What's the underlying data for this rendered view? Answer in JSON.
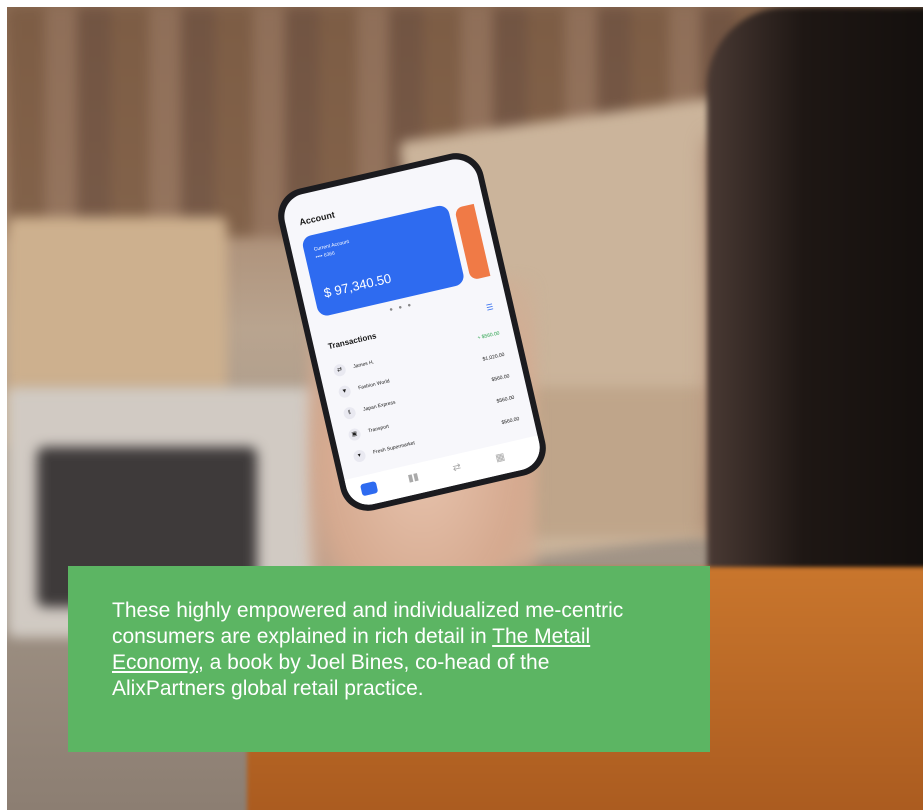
{
  "phone": {
    "account_title": "Account",
    "card_label": "Current Account",
    "card_number": "•••• 6366",
    "card_balance": "$ 97,340.50",
    "transactions_title": "Transactions",
    "transactions": [
      {
        "name": "James H.",
        "amount": "+ $560.00"
      },
      {
        "name": "Fashion World",
        "amount": "$1,020.00"
      },
      {
        "name": "Japan Express",
        "amount": "$560.00"
      },
      {
        "name": "Transport",
        "amount": "$560.00"
      },
      {
        "name": "Fresh Supermarket",
        "amount": "$560.00"
      }
    ]
  },
  "callout": {
    "text_before": "These highly empowered and individualized me-centric consumers are explained in rich detail in ",
    "link_text": "The Metail Economy",
    "text_after": ", a book by Joel Bines, co-head of the AlixPartners global retail practice."
  },
  "colors": {
    "callout_bg": "#5cb563",
    "card_blue": "#2e6bf0"
  }
}
